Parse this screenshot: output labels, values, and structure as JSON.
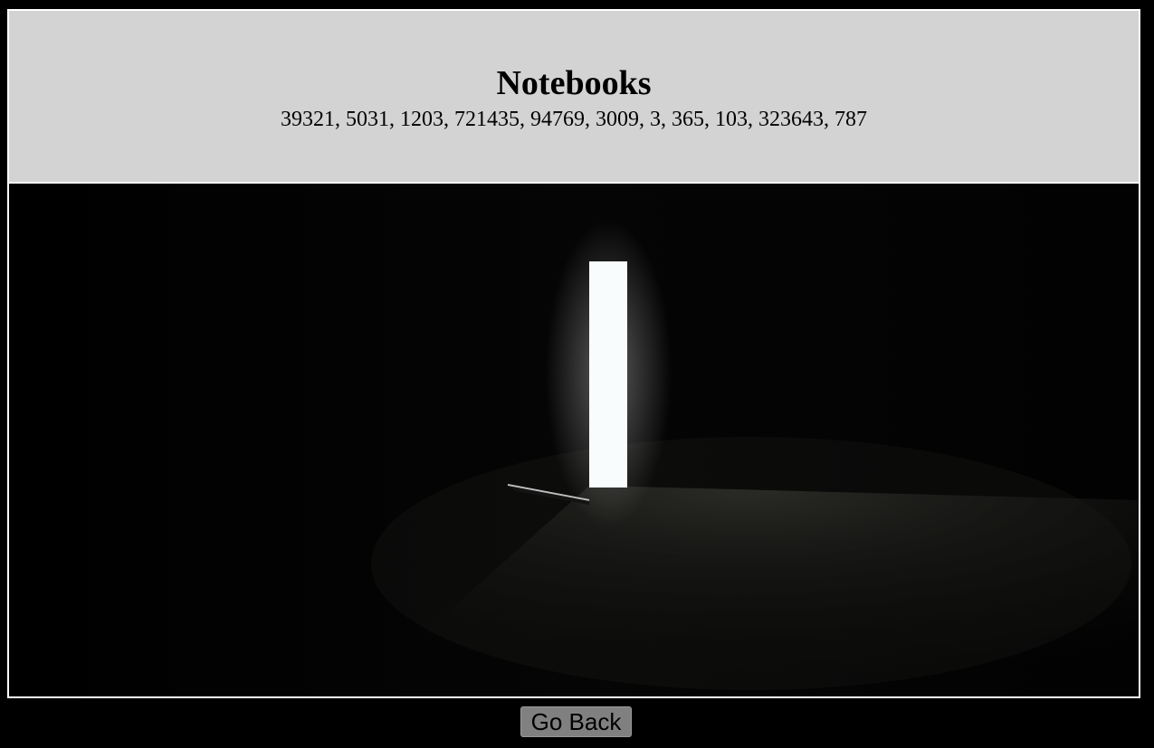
{
  "header": {
    "title": "Notebooks",
    "numbers": "39321, 5031, 1203, 721435, 94769, 3009, 3, 365, 103, 323643, 787"
  },
  "image": {
    "subject": "lit-doorway-icon"
  },
  "actions": {
    "go_back_label": "Go Back"
  },
  "colors": {
    "page_background": "#000000",
    "header_background": "#d3d3d3",
    "frame_border": "#ffffff",
    "button_background": "#808080"
  }
}
